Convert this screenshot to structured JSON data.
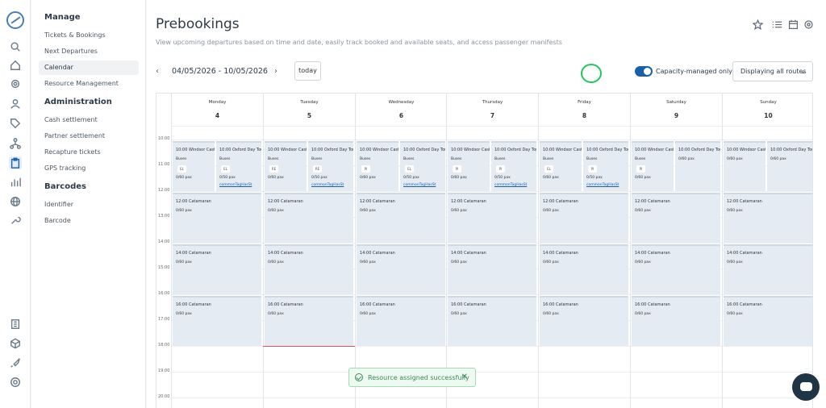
{
  "sidebar": {
    "sections": [
      {
        "title": "Manage",
        "items": [
          "Tickets & Bookings",
          "Next Departures",
          "Calendar",
          "Resource Management"
        ]
      },
      {
        "title": "Administration",
        "items": [
          "Cash settlement",
          "Partner settlement",
          "Recapture tickets",
          "GPS tracking"
        ]
      },
      {
        "title": "Barcodes",
        "items": [
          "Identifier",
          "Barcode"
        ]
      }
    ],
    "active_item": "Calendar"
  },
  "page": {
    "title": "Prebookings",
    "subtitle": "View upcoming departures based on time and date, easily track booked and available seats, and access passenger manifests"
  },
  "toolbar": {
    "date_range": "04/05/2026 - 10/05/2026",
    "prev": "‹",
    "next": "›",
    "today_label": "today",
    "capacity_toggle_label": "Capacity-managed only",
    "capacity_toggle_on": true,
    "route_select_value": "Displaying all routes",
    "chevron": "⌄"
  },
  "calendar": {
    "days": [
      {
        "name": "Monday",
        "date": "4"
      },
      {
        "name": "Tuesday",
        "date": "5"
      },
      {
        "name": "Wednesday",
        "date": "6"
      },
      {
        "name": "Thursday",
        "date": "7"
      },
      {
        "name": "Friday",
        "date": "8"
      },
      {
        "name": "Saturday",
        "date": "9"
      },
      {
        "name": "Sunday",
        "date": "10"
      }
    ],
    "times": [
      "10:00",
      "11:00",
      "12:00",
      "13:00",
      "14:00",
      "15:00",
      "16:00",
      "17:00",
      "18:00",
      "19:00",
      "20:00"
    ],
    "events": {
      "windsor": {
        "title": "10:00  Windsor Castle",
        "kind": "Buses",
        "pax": "0/60 pax"
      },
      "oxford": {
        "title": "10:00  Oxford Day Tour",
        "kind": "Buses",
        "pax": "0/50 pax",
        "tag": "commonTagHasSt"
      },
      "cat12": {
        "title": "12:00  Catamaran",
        "pax": "0/60 pax"
      },
      "cat14": {
        "title": "14:00  Catamaran",
        "pax": "0/60 pax"
      },
      "cat16": {
        "title": "16:00  Catamaran",
        "pax": "0/60 pax"
      }
    },
    "badges": {
      "mon": [
        "EL",
        "EL"
      ],
      "tue": [
        "RE",
        "RE"
      ],
      "wed": [
        "PI",
        "EL"
      ],
      "thu": [
        "PI",
        "PI"
      ],
      "fri": [
        "EL",
        "PI"
      ],
      "sat": [
        "PI"
      ]
    },
    "saturday_oxford_pax": "0/60 pax"
  },
  "toast": {
    "message": "Resource assigned successfully",
    "close": "✕"
  },
  "colors": {
    "accent": "#1a5fa8",
    "success": "#3b8a57",
    "event_bg": "#e4ebf3"
  }
}
